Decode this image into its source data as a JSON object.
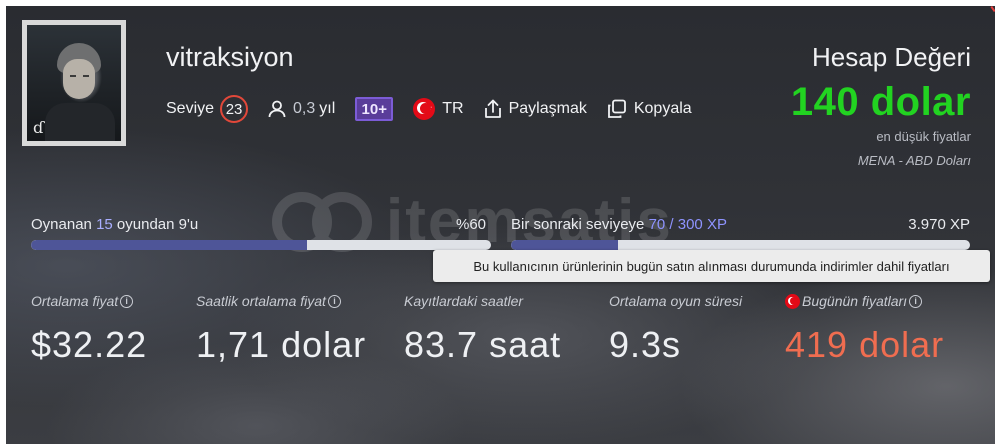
{
  "profile": {
    "username": "vitraksiyon",
    "avatar_tag": "ɗ",
    "level_label": "Seviye",
    "level": "23",
    "account_age_value": "0,3",
    "account_age_unit": "yıl",
    "badge": "10+",
    "country": "TR",
    "share_label": "Paylaşmak",
    "copy_label": "Kopyala"
  },
  "account_value": {
    "title": "Hesap Değeri",
    "amount": "140 dolar",
    "subtitle": "en düşük fiyatlar",
    "region": "MENA - ABD Doları",
    "color": "#22d321"
  },
  "watermark": "itemsatis",
  "games_progress": {
    "prefix": "Oynanan",
    "total": "15",
    "middle": "oyundan",
    "played": "9'u",
    "percent_label": "%60",
    "fraction": 0.6
  },
  "xp_progress": {
    "label": "Bir sonraki seviyeye",
    "xp": "70 / 300 XP",
    "total_xp": "3.970 XP",
    "fraction": 0.233
  },
  "tooltip": "Bu kullanıcının ürünlerinin bugün satın alınması durumunda indirimler dahil fiyatları",
  "stats": [
    {
      "label": "Ortalama fiyat",
      "value": "$32.22",
      "info": true
    },
    {
      "label": "Saatlik ortalama fiyat",
      "value": "1,71 dolar",
      "info": true
    },
    {
      "label": "Kayıtlardaki saatler",
      "value": "83.7 saat",
      "info": false
    },
    {
      "label": "Ortalama oyun süresi",
      "value": "9.3s",
      "info": false
    },
    {
      "label": "Bugünün fiyatları",
      "value": "419 dolar",
      "info": true,
      "accent": "#f06d50"
    }
  ],
  "icons": {
    "user": "user-icon",
    "share": "share-icon",
    "copy": "copy-icon",
    "info": "info-icon",
    "flag": "turkey-flag-icon"
  }
}
